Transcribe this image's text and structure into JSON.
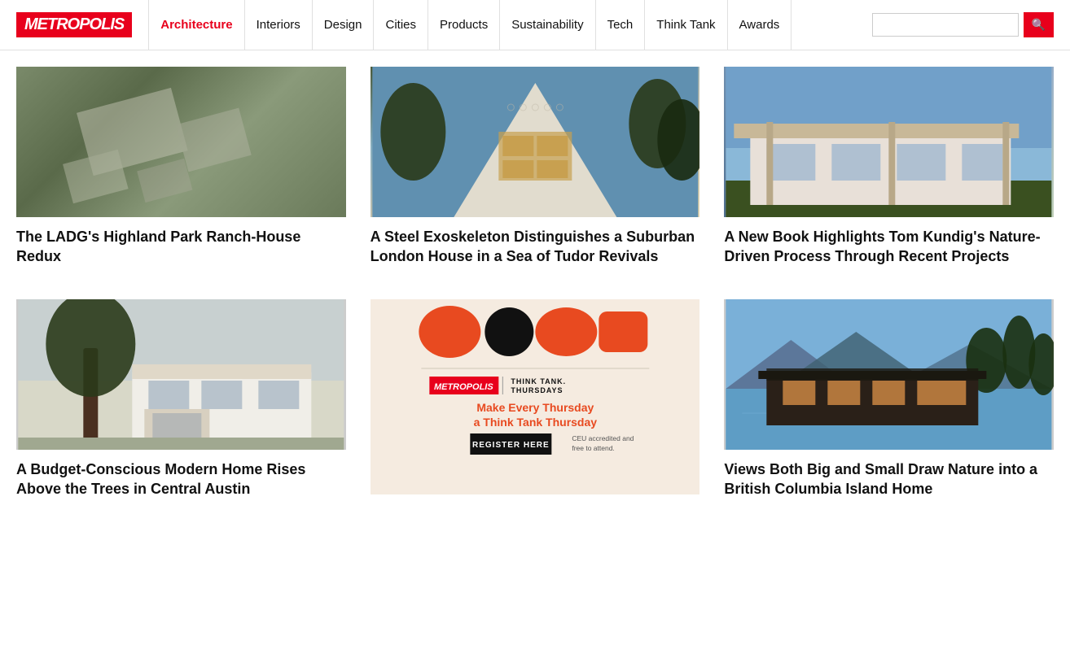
{
  "header": {
    "logo": "METROPOLIS",
    "nav_items": [
      {
        "label": "Architecture",
        "active": true
      },
      {
        "label": "Interiors",
        "active": false
      },
      {
        "label": "Design",
        "active": false
      },
      {
        "label": "Cities",
        "active": false
      },
      {
        "label": "Products",
        "active": false
      },
      {
        "label": "Sustainability",
        "active": false
      },
      {
        "label": "Tech",
        "active": false
      },
      {
        "label": "Think Tank",
        "active": false
      },
      {
        "label": "Awards",
        "active": false
      }
    ],
    "search_placeholder": ""
  },
  "articles": {
    "row1": [
      {
        "title": "The LADG's Highland Park Ranch-House Redux",
        "image_type": "aerial"
      },
      {
        "title": "A Steel Exoskeleton Distinguishes a Suburban London House in a Sea of Tudor Revivals",
        "image_type": "white-building"
      },
      {
        "title": "A New Book Highlights Tom Kundig's Nature-Driven Process Through Recent Projects",
        "image_type": "modern-house"
      }
    ],
    "row2": [
      {
        "title": "A Budget-Conscious Modern Home Rises Above the Trees in Central Austin",
        "image_type": "trees-house"
      },
      {
        "title": "ad",
        "ad": true,
        "ad_logo": "METROPOLIS",
        "ad_think_tank": "THINK TANK.",
        "ad_thursdays": "THURSDAYS",
        "ad_make": "Make Every Thursday\na Think Tank Thursday",
        "ad_register": "REGISTER HERE",
        "ad_ceu": "CEU accredited and\nfree to attend."
      },
      {
        "title": "Views Both Big and Small Draw Nature into a British Columbia Island Home",
        "image_type": "waterfront"
      }
    ]
  }
}
